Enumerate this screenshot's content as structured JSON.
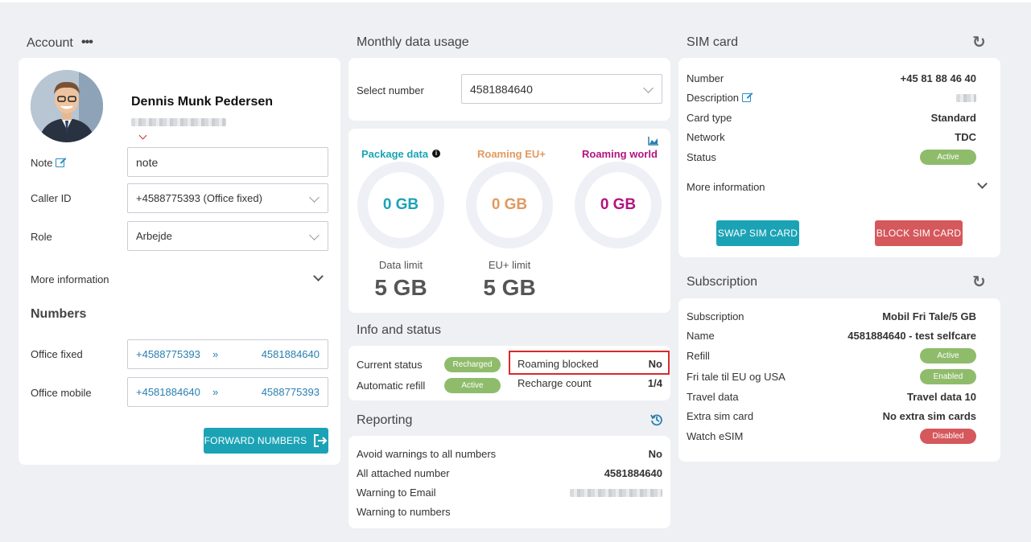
{
  "account": {
    "title": "Account",
    "menu_icon": "ellipsis-icon",
    "name": "Dennis Munk Pedersen",
    "note_label": "Note",
    "note_value": "note",
    "caller_id_label": "Caller ID",
    "caller_id_value": "+4588775393 (Office fixed)",
    "role_label": "Role",
    "role_value": "Arbejde",
    "more_info": "More information",
    "numbers_title": "Numbers",
    "numbers": [
      {
        "label": "Office fixed",
        "from": "+4588775393",
        "arrow": "»",
        "to": "4581884640"
      },
      {
        "label": "Office mobile",
        "from": "+4581884640",
        "arrow": "»",
        "to": "4588775393"
      }
    ],
    "forward_button": "FORWARD NUMBERS"
  },
  "usage": {
    "title": "Monthly data usage",
    "select_label": "Select number",
    "select_value": "4581884640",
    "package": {
      "label": "Package data",
      "value": "0 GB",
      "color": "#1ba3b5"
    },
    "roaming_eu": {
      "label": "Roaming EU+",
      "value": "0 GB",
      "color": "#e09a60"
    },
    "roaming_world": {
      "label": "Roaming world",
      "value": "0 GB",
      "color": "#b3137f"
    },
    "data_limit_label": "Data limit",
    "data_limit_value": "5 GB",
    "eu_limit_label": "EU+ limit",
    "eu_limit_value": "5 GB"
  },
  "info": {
    "title": "Info and status",
    "current_status_label": "Current status",
    "current_status_value": "Recharged",
    "auto_refill_label": "Automatic refill",
    "auto_refill_value": "Active",
    "roaming_blocked_label": "Roaming blocked",
    "roaming_blocked_value": "No",
    "recharge_count_label": "Recharge count",
    "recharge_count_value": "1/4"
  },
  "reporting": {
    "title": "Reporting",
    "rows": [
      {
        "label": "Avoid warnings to all numbers",
        "value": "No"
      },
      {
        "label": "All attached number",
        "value": "4581884640"
      },
      {
        "label": "Warning to Email",
        "value": ""
      },
      {
        "label": "Warning to numbers",
        "value": ""
      }
    ]
  },
  "sim": {
    "title": "SIM card",
    "number_label": "Number",
    "number_value": "+45 81 88 46 40",
    "description_label": "Description",
    "card_type_label": "Card type",
    "card_type_value": "Standard",
    "network_label": "Network",
    "network_value": "TDC",
    "status_label": "Status",
    "status_value": "Active",
    "more_info": "More information",
    "swap_button": "SWAP SIM CARD",
    "block_button": "BLOCK SIM CARD"
  },
  "subscription": {
    "title": "Subscription",
    "rows": [
      {
        "label": "Subscription",
        "value": "Mobil Fri Tale/5 GB"
      },
      {
        "label": "Name",
        "value": "4581884640 - test selfcare"
      },
      {
        "label": "Refill",
        "value": "Active"
      },
      {
        "label": "Fri tale til EU og USA",
        "value": "Enabled"
      },
      {
        "label": "Travel data",
        "value": "Travel data 10"
      },
      {
        "label": "Extra sim card",
        "value": "No extra sim cards"
      },
      {
        "label": "Watch eSIM",
        "value": "Disabled"
      }
    ]
  }
}
